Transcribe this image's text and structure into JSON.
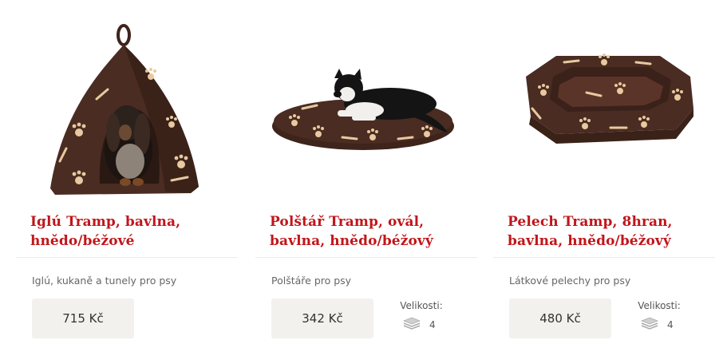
{
  "products": [
    {
      "title_line1": "Iglú Tramp, bavlna,",
      "title_line2": "hnědo/béžové",
      "category": "Iglú, kukaně a tunely pro psy",
      "price": "715 Kč",
      "image_icon": "igloo-dog-bed-image"
    },
    {
      "title_line1": "Polštář Tramp, ovál,",
      "title_line2": "bavlna, hnědo/béžový",
      "category": "Polštáře pro psy",
      "price": "342 Kč",
      "sizes_label": "Velikosti:",
      "sizes_count": "4",
      "image_icon": "oval-cushion-dog-image"
    },
    {
      "title_line1": "Pelech Tramp, 8hran,",
      "title_line2": "bavlna, hnědo/béžový",
      "category": "Látkové pelechy pro psy",
      "price": "480 Kč",
      "sizes_label": "Velikosti:",
      "sizes_count": "4",
      "image_icon": "octagon-dog-bed-image"
    }
  ],
  "colors": {
    "title": "#c0161b",
    "bed_brown": "#4a2c22",
    "paw_beige": "#e8c9a0",
    "price_bg": "#f3f1ee"
  }
}
